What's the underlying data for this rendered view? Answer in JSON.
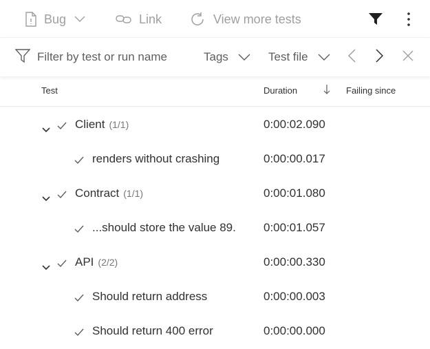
{
  "toolbar": {
    "bug_label": "Bug",
    "link_label": "Link",
    "view_more_label": "View more tests"
  },
  "filter": {
    "placeholder": "Filter by test or run name",
    "tags_label": "Tags",
    "test_file_label": "Test file"
  },
  "columns": {
    "test": "Test",
    "duration": "Duration",
    "failing_since": "Failing since"
  },
  "rows": [
    {
      "type": "group",
      "name": "Client",
      "count": "(1/1)",
      "duration": "0:00:02.090"
    },
    {
      "type": "test",
      "name": "renders without crashing",
      "duration": "0:00:00.017"
    },
    {
      "type": "group",
      "name": "Contract",
      "count": "(1/1)",
      "duration": "0:00:01.080"
    },
    {
      "type": "test",
      "name": "...should store the value 89.",
      "duration": "0:00:01.057"
    },
    {
      "type": "group",
      "name": "API",
      "count": "(2/2)",
      "duration": "0:00:00.330"
    },
    {
      "type": "test",
      "name": "Should return address",
      "duration": "0:00:00.003"
    },
    {
      "type": "test",
      "name": "Should return 400 error",
      "duration": "0:00:00.000"
    }
  ],
  "colors": {
    "disabled_text": "#a19f9d",
    "text": "#323130",
    "secondary_text": "#605e5c",
    "check": "#605e5c"
  }
}
